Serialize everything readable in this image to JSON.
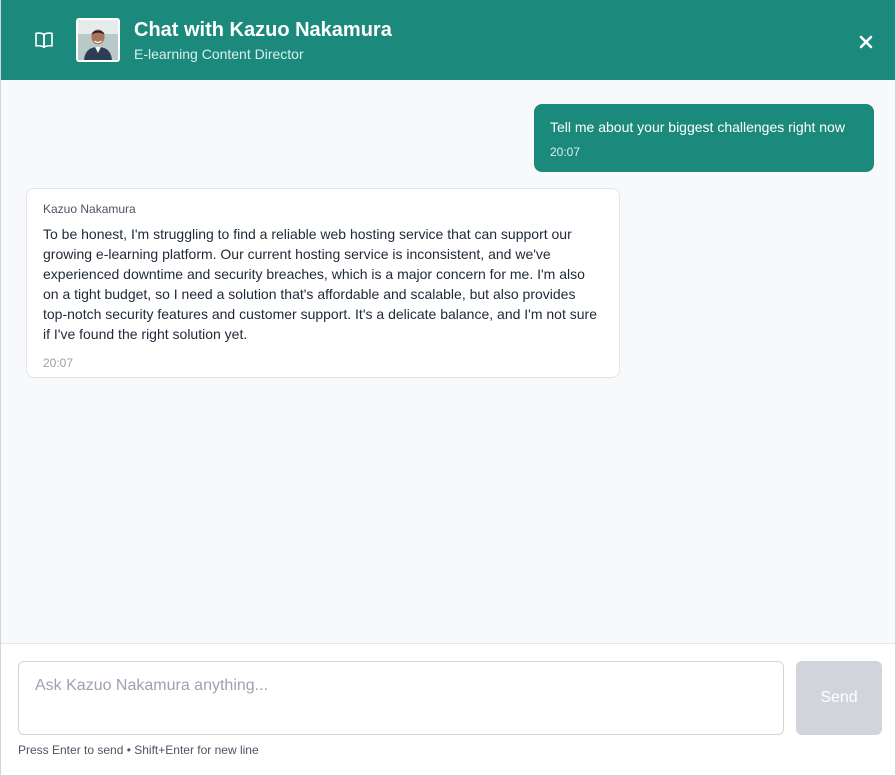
{
  "header": {
    "title": "Chat with Kazuo Nakamura",
    "subtitle": "E-learning Content Director",
    "book_icon": "book-open-icon",
    "close_icon": "close-icon",
    "color": "#1b8a7c"
  },
  "messages": [
    {
      "role": "user",
      "text": "Tell me about your biggest challenges right now",
      "time": "20:07"
    },
    {
      "role": "assistant",
      "sender": "Kazuo Nakamura",
      "text": "To be honest, I'm struggling to find a reliable web hosting service that can support our growing e-learning platform. Our current hosting service is inconsistent, and we've experienced downtime and security breaches, which is a major concern for me. I'm also on a tight budget, so I need a solution that's affordable and scalable, but also provides top-notch security features and customer support. It's a delicate balance, and I'm not sure if I've found the right solution yet.",
      "time": "20:07"
    }
  ],
  "composer": {
    "placeholder": "Ask Kazuo Nakamura anything...",
    "value": "",
    "send_label": "Send",
    "hint": "Press Enter to send • Shift+Enter for new line"
  }
}
